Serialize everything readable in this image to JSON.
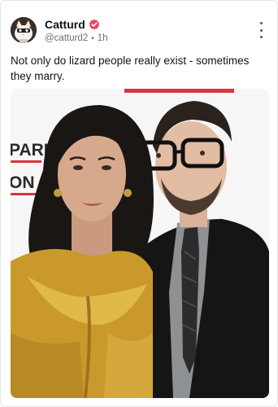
{
  "post": {
    "author": {
      "display_name": "Catturd",
      "handle": "@catturd2",
      "time": "1h",
      "separator": "•",
      "verified_badge_color": "#e8475f"
    },
    "text": "Not only do lizard people really exist - sometimes they marry.",
    "media": {
      "backdrop_text": [
        "PARK",
        "ON"
      ],
      "accent_color": "#d9363e"
    },
    "icons": {
      "avatar": "cat-avatar",
      "verified": "verified-badge-icon",
      "more": "more-vertical-icon"
    }
  }
}
